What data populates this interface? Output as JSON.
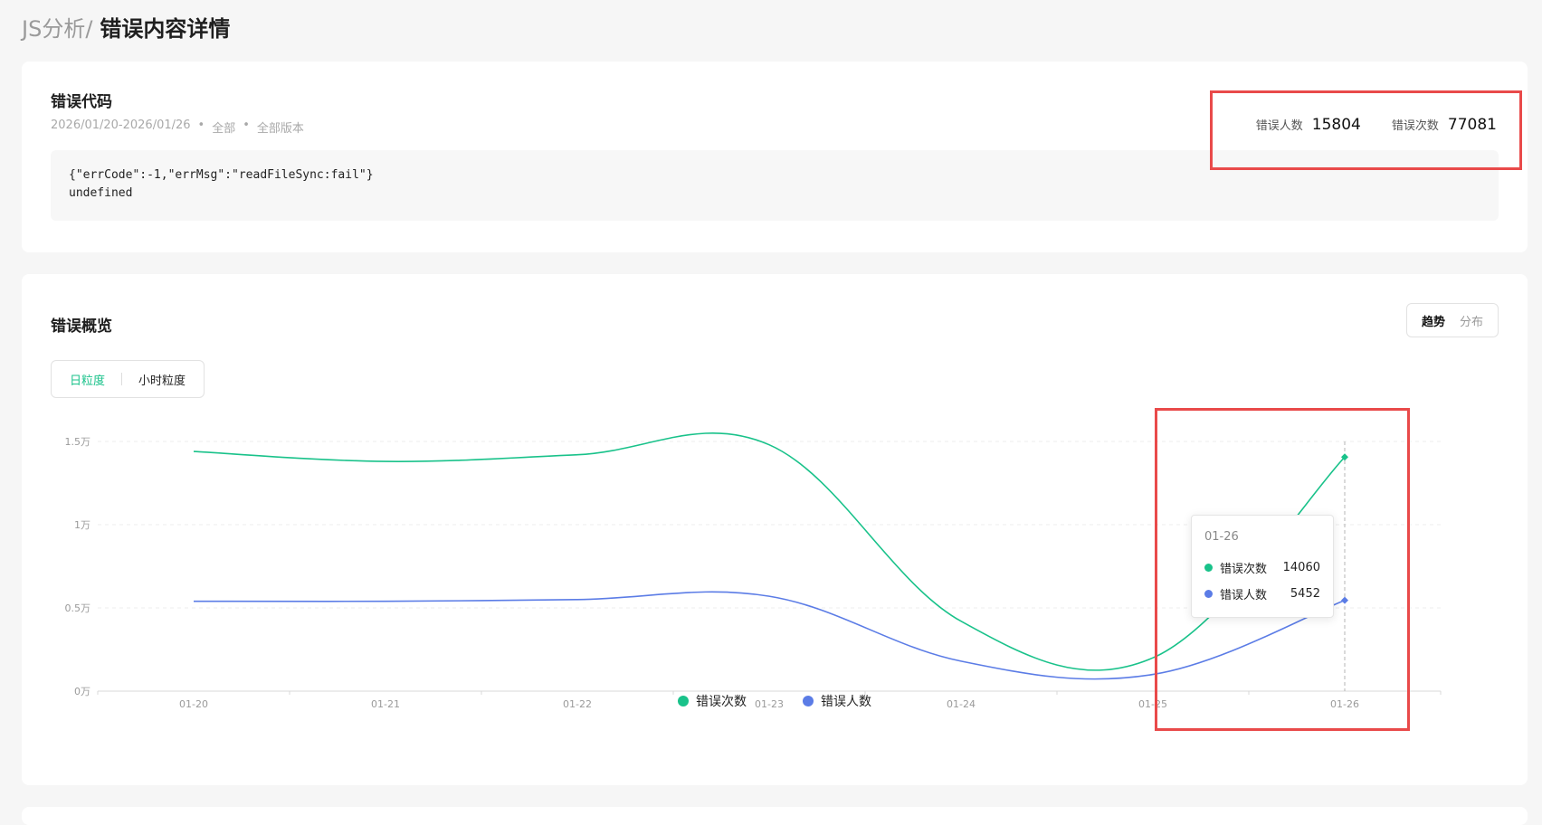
{
  "breadcrumb": {
    "parent": "JS分析",
    "separator": "/",
    "current": "错误内容详情"
  },
  "error_card": {
    "title": "错误代码",
    "date_range": "2026/01/20-2026/01/26",
    "scope": "全部",
    "version": "全部版本",
    "code_line1": "{\"errCode\":-1,\"errMsg\":\"readFileSync:fail\"}",
    "code_line2": "undefined",
    "stats": [
      {
        "label": "错误人数",
        "value": "15804"
      },
      {
        "label": "错误次数",
        "value": "77081"
      }
    ]
  },
  "overview_card": {
    "title": "错误概览",
    "view_tabs": [
      {
        "label": "趋势",
        "active": true
      },
      {
        "label": "分布",
        "active": false
      }
    ],
    "granularity_tabs": [
      {
        "label": "日粒度",
        "active": true
      },
      {
        "label": "小时粒度",
        "active": false
      }
    ],
    "tooltip": {
      "date": "01-26",
      "rows": [
        {
          "name": "错误次数",
          "value": "14060"
        },
        {
          "name": "错误人数",
          "value": "5452"
        }
      ]
    }
  },
  "colors": {
    "green": "#19c28a",
    "blue": "#5b7ce6",
    "red_annotation": "#e94a4a"
  },
  "chart_data": {
    "type": "line",
    "x": [
      "01-20",
      "01-21",
      "01-22",
      "01-23",
      "01-24",
      "01-25",
      "01-26"
    ],
    "y_ticks": [
      "0万",
      "0.5万",
      "1万",
      "1.5万"
    ],
    "ylim": [
      0,
      15000
    ],
    "grid": true,
    "legend_position": "bottom",
    "series": [
      {
        "name": "错误次数",
        "color": "#19c28a",
        "values": [
          14400,
          13800,
          14200,
          14800,
          4200,
          2000,
          14060
        ]
      },
      {
        "name": "错误人数",
        "color": "#5b7ce6",
        "values": [
          5400,
          5400,
          5500,
          5700,
          1800,
          1000,
          5452
        ]
      }
    ]
  }
}
